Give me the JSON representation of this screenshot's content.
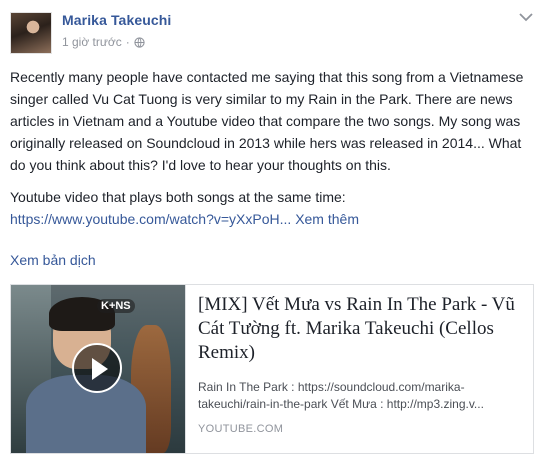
{
  "post": {
    "author": "Marika Takeuchi",
    "timestamp": "1 giờ trước",
    "separator": "·",
    "paragraph1": "Recently many people have contacted me saying that this song from a Vietnamese singer called Vu Cat Tuong is very similar to my Rain in the Park. There are news articles in Vietnam and a Youtube video that compare the two songs. My song was originally released on Soundcloud in 2013 while hers was released in 2014... What do you think about this? I'd love to hear your thoughts on this.",
    "paragraph2_text": "Youtube video that plays both songs at the same time:",
    "paragraph2_link": "https://www.youtube.com/watch?v=yXxPoH...",
    "see_more": "Xem thêm",
    "translate": "Xem bản dịch"
  },
  "card": {
    "thumb_logo": "K+NS",
    "title": "[MIX] Vết Mưa vs Rain In The Park - Vũ Cát Tường ft. Marika Takeuchi (Cellos Remix)",
    "description": "Rain In The Park : https://soundcloud.com/marika-takeuchi/rain-in-the-park Vết Mưa : http://mp3.zing.v...",
    "source": "YOUTUBE.COM"
  },
  "icons": {
    "globe": "globe-icon",
    "chevron": "chevron-down-icon",
    "play": "play-icon"
  },
  "colors": {
    "link": "#365899",
    "meta": "#90949c",
    "text": "#1d2129"
  }
}
